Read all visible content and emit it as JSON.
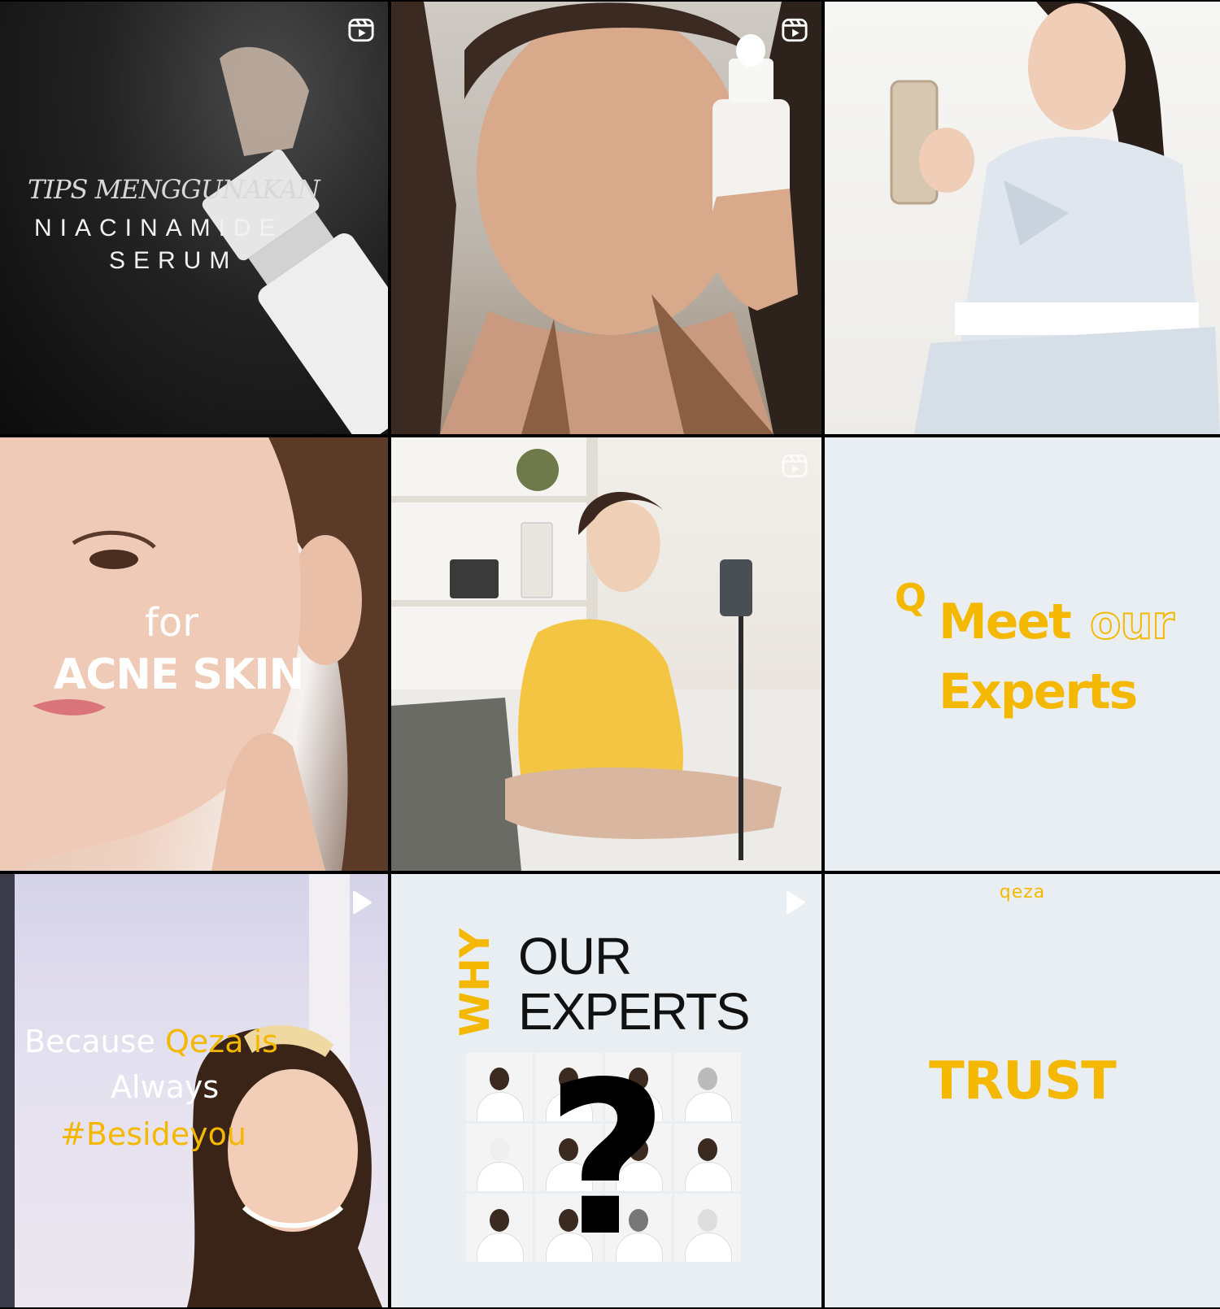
{
  "posts": [
    {
      "type": "reel",
      "icon": "reels-icon",
      "script_text": "TIPS MENGGUNAKAN",
      "line1": "NIACINAMIDE",
      "line2": "SERUM"
    },
    {
      "type": "reel",
      "icon": "reels-icon"
    },
    {
      "type": "image"
    },
    {
      "type": "image",
      "small": "for",
      "big": "ACNE SKIN"
    },
    {
      "type": "reel",
      "icon": "reels-icon"
    },
    {
      "type": "image",
      "mark": "Q",
      "line1a": "Meet",
      "line1b": "our",
      "line2": "Experts"
    },
    {
      "type": "video",
      "icon": "play-icon",
      "l1a": "Because",
      "l1b": "Qeza is",
      "l2": "Always",
      "l3": "#Besideyou"
    },
    {
      "type": "video",
      "icon": "play-icon",
      "why": "WHY",
      "our": "OUR",
      "experts": "EXPERTS",
      "qmark": "?"
    },
    {
      "type": "image",
      "logo": "qeza",
      "word": "TRUST"
    }
  ],
  "colors": {
    "accent": "#f5b800",
    "panel": "#e9eef2",
    "grid_gap": "#000000"
  }
}
